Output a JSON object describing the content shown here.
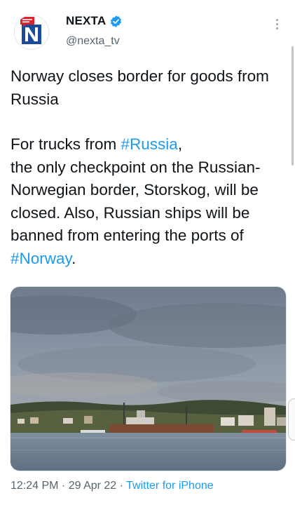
{
  "account": {
    "name": "NEXTA",
    "handle": "@nexta_tv",
    "verified_icon": "verified-badge-icon",
    "avatar_icon": "nexta-logo"
  },
  "menu": {
    "icon": "more-vertical-icon"
  },
  "tweet": {
    "headline": "Norway closes border for goods from Russia",
    "body_part1": "For trucks from ",
    "hashtag_russia": "#Russia",
    "body_part2": ",",
    "body_part3": "the only checkpoint on the Russian-Norwegian border, Storskog, will be closed. Also, Russian ships will be banned from entering the ports of ",
    "hashtag_norway": "#Norway",
    "body_part4": "."
  },
  "meta": {
    "time": "12:24 PM",
    "separator": " · ",
    "date": "29 Apr 22",
    "source": "Twitter for iPhone"
  },
  "colors": {
    "link": "#1d9bf0",
    "secondary_text": "#536471",
    "brand_red": "#e0202a",
    "brand_blue": "#1c4b9c"
  }
}
